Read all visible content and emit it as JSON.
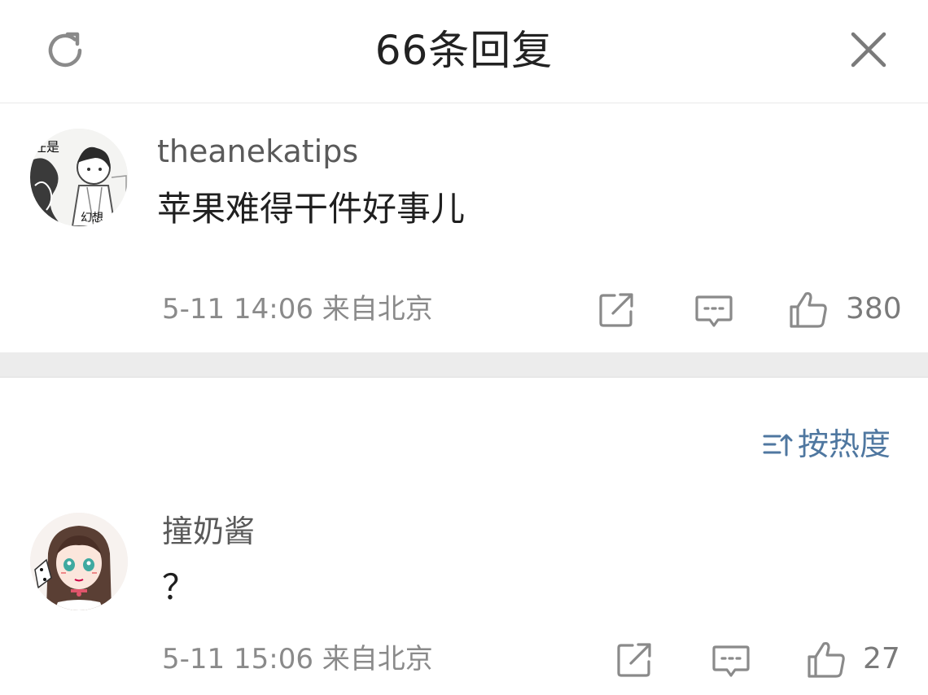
{
  "header": {
    "title": "66条回复",
    "refresh_icon": "refresh-icon",
    "close_icon": "close-icon"
  },
  "main_comment": {
    "username": "theanekatips",
    "text": "苹果难得干件好事儿",
    "meta": "5-11 14:06 来自北京",
    "like_count": "380",
    "avatar_caption_top": "任是",
    "avatar_caption_bottom": "幻想",
    "icons": [
      "share-icon",
      "comment-icon",
      "thumbs-up-icon"
    ]
  },
  "sort": {
    "label": "按热度",
    "icon": "sort-icon",
    "accent": "#4f77a0"
  },
  "replies": [
    {
      "username": "撞奶酱",
      "text": "？",
      "meta": "5-11 15:06 来自北京",
      "like_count": "27"
    }
  ]
}
